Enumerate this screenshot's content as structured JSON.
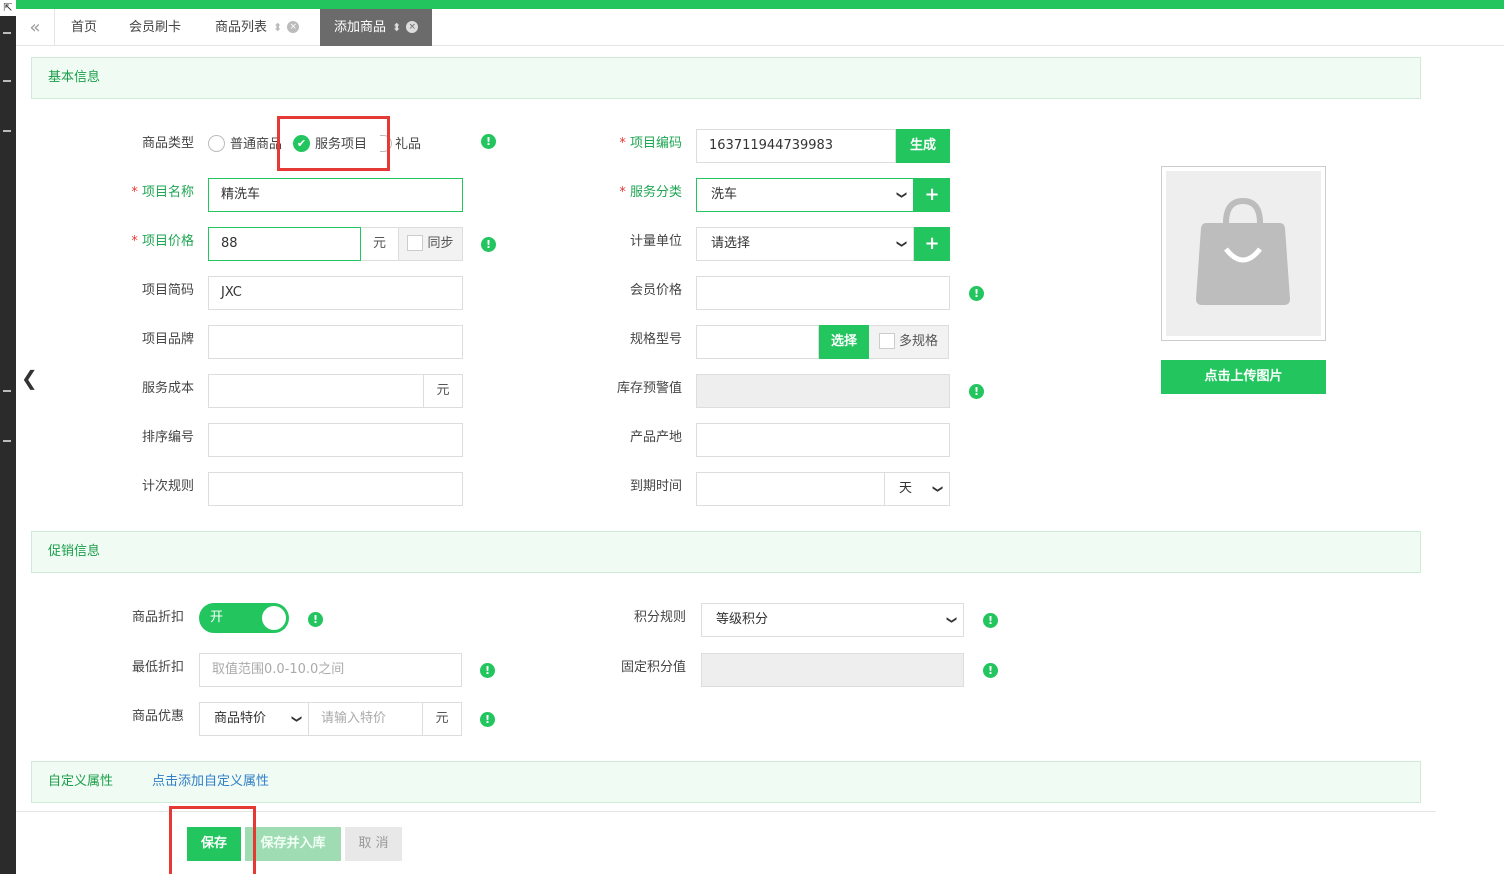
{
  "tabs": [
    {
      "label": "首页"
    },
    {
      "label": "会员刷卡"
    },
    {
      "label": "商品列表"
    },
    {
      "label": "添加商品"
    }
  ],
  "sections": {
    "basic": "基本信息",
    "promo": "促销信息",
    "custom": "自定义属性",
    "custom_link": "点击添加自定义属性"
  },
  "basic": {
    "type_label": "商品类型",
    "type_options": [
      "普通商品",
      "服务项目",
      "礼品"
    ],
    "type_selected": "服务项目",
    "code_label": "项目编码",
    "code_value": "163711944739983",
    "generate_btn": "生成",
    "name_label": "项目名称",
    "name_value": "精洗车",
    "category_label": "服务分类",
    "category_value": "洗车",
    "price_label": "项目价格",
    "price_value": "88",
    "price_unit": "元",
    "sync_label": "同步",
    "unit_label": "计量单位",
    "unit_value": "请选择",
    "abbr_label": "项目简码",
    "abbr_value": "JXC",
    "member_price_label": "会员价格",
    "brand_label": "项目品牌",
    "spec_label": "规格型号",
    "spec_btn": "选择",
    "multi_spec_label": "多规格",
    "cost_label": "服务成本",
    "cost_unit": "元",
    "stock_warn_label": "库存预警值",
    "sort_label": "排序编号",
    "origin_label": "产品产地",
    "count_rule_label": "计次规则",
    "expire_label": "到期时间",
    "expire_unit": "天",
    "upload_btn": "点击上传图片"
  },
  "promo": {
    "discount_label": "商品折扣",
    "discount_toggle": "开",
    "points_rule_label": "积分规则",
    "points_rule_value": "等级积分",
    "min_discount_label": "最低折扣",
    "min_discount_placeholder": "取值范围0.0-10.0之间",
    "fixed_points_label": "固定积分值",
    "offer_label": "商品优惠",
    "offer_type": "商品特价",
    "offer_placeholder": "请输入特价",
    "offer_unit": "元"
  },
  "actions": {
    "save": "保存",
    "save_stock": "保存并入库",
    "cancel": "取 消"
  },
  "colors": {
    "accent": "#22c55e",
    "highlight": "#e53935"
  }
}
